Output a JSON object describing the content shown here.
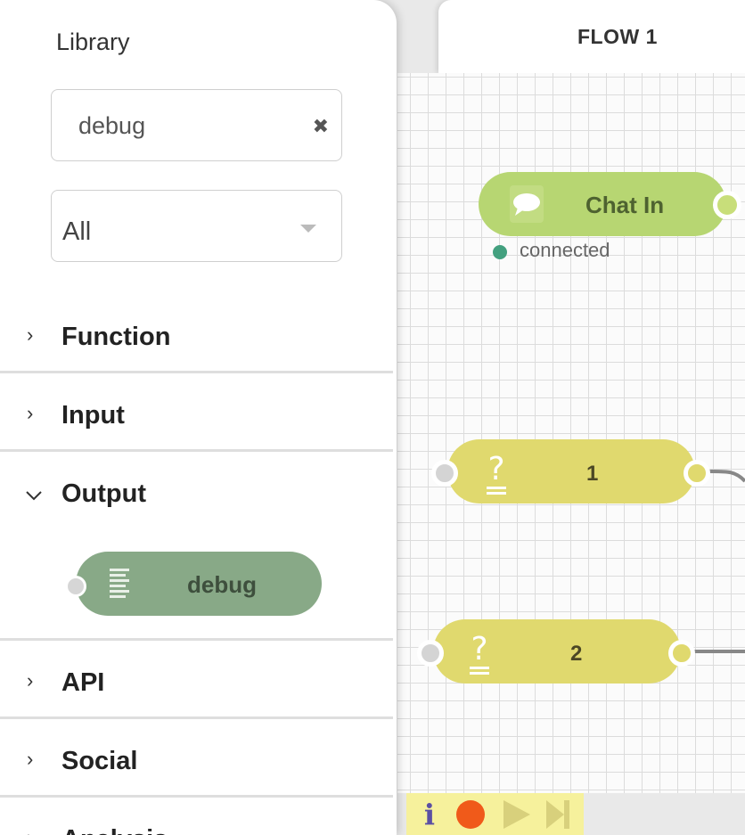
{
  "sidebar": {
    "title": "Library",
    "search": {
      "value": "debug",
      "clear_icon": "close-icon"
    },
    "filter": {
      "value": "All",
      "icon": "chevron-down-icon"
    },
    "categories": [
      {
        "label": "Function",
        "expanded": false
      },
      {
        "label": "Input",
        "expanded": false
      },
      {
        "label": "Output",
        "expanded": true,
        "items": [
          {
            "label": "debug",
            "icon": "list-icon",
            "color": "#88a987"
          }
        ]
      },
      {
        "label": "API",
        "expanded": false
      },
      {
        "label": "Social",
        "expanded": false
      },
      {
        "label": "Analysis",
        "expanded": false
      }
    ]
  },
  "tab": {
    "label": "FLOW 1"
  },
  "canvas": {
    "nodes": [
      {
        "label": "Chat In",
        "icon": "chat-bubble-icon",
        "color": "#b7d672",
        "status": "connected",
        "status_color": "#43a07f"
      },
      {
        "label": "1",
        "icon": "question-icon",
        "color": "#e0d96e"
      },
      {
        "label": "2",
        "icon": "question-icon",
        "color": "#e0d96e"
      }
    ]
  },
  "toolbar": {
    "info": "i",
    "icons": [
      "info-icon",
      "record-icon",
      "play-icon",
      "step-forward-icon"
    ],
    "background": "#f6f19c",
    "record_color": "#f05a1a"
  }
}
